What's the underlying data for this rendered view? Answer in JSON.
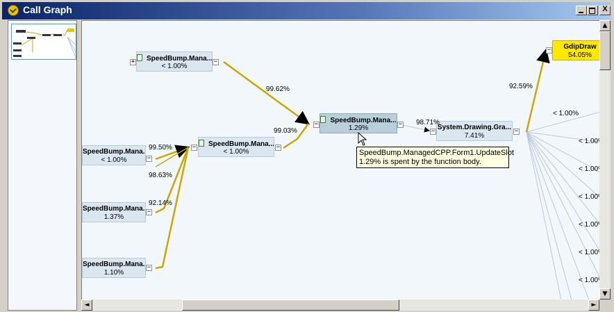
{
  "window": {
    "title": "Call Graph"
  },
  "title_buttons": {
    "minimize": "_",
    "maximize": "",
    "close": "X"
  },
  "nodes": [
    {
      "name": "SpeedBump.Mana...",
      "pct": "< 1.00%"
    },
    {
      "name": "SpeedBump.Mana...",
      "pct": "< 1.00%"
    },
    {
      "name": "SpeedBump.Mana...",
      "pct": "1.37%"
    },
    {
      "name": "SpeedBump.Mana...",
      "pct": "1.10%"
    },
    {
      "name": "SpeedBump.Mana...",
      "pct": "< 1.00%"
    },
    {
      "name": "SpeedBump.Mana...",
      "pct": "1.29%"
    },
    {
      "name": "System.Drawing.Gra...",
      "pct": "7.41%"
    },
    {
      "name": "GdipDraw",
      "pct": "54.05%"
    }
  ],
  "edge_labels": [
    "99.62%",
    "99.03%",
    "99.50%",
    "98.63%",
    "92.14%",
    "98.71%",
    "92.59%",
    "< 1.00%",
    "< 1.00%",
    "< 1.00%",
    "< 1.00%",
    "< 1.00%",
    "< 1.00%",
    "< 1.00%"
  ],
  "expanders": {
    "plus": "+",
    "minus": "−"
  },
  "tooltip": {
    "line1": "SpeedBump.ManagedCPP.Form1.UpdateSlot",
    "line2": "1.29% is spent by the function body."
  },
  "scrollbar": {
    "up": "▲",
    "down": "▼",
    "left": "◄",
    "right": "►"
  },
  "colors": {
    "edge": "#c8a800",
    "hot_node": "#ffe800",
    "node": "#dbe7f0",
    "selected_node": "#b8cfdc",
    "thin_edge": "#b8c8dc"
  }
}
